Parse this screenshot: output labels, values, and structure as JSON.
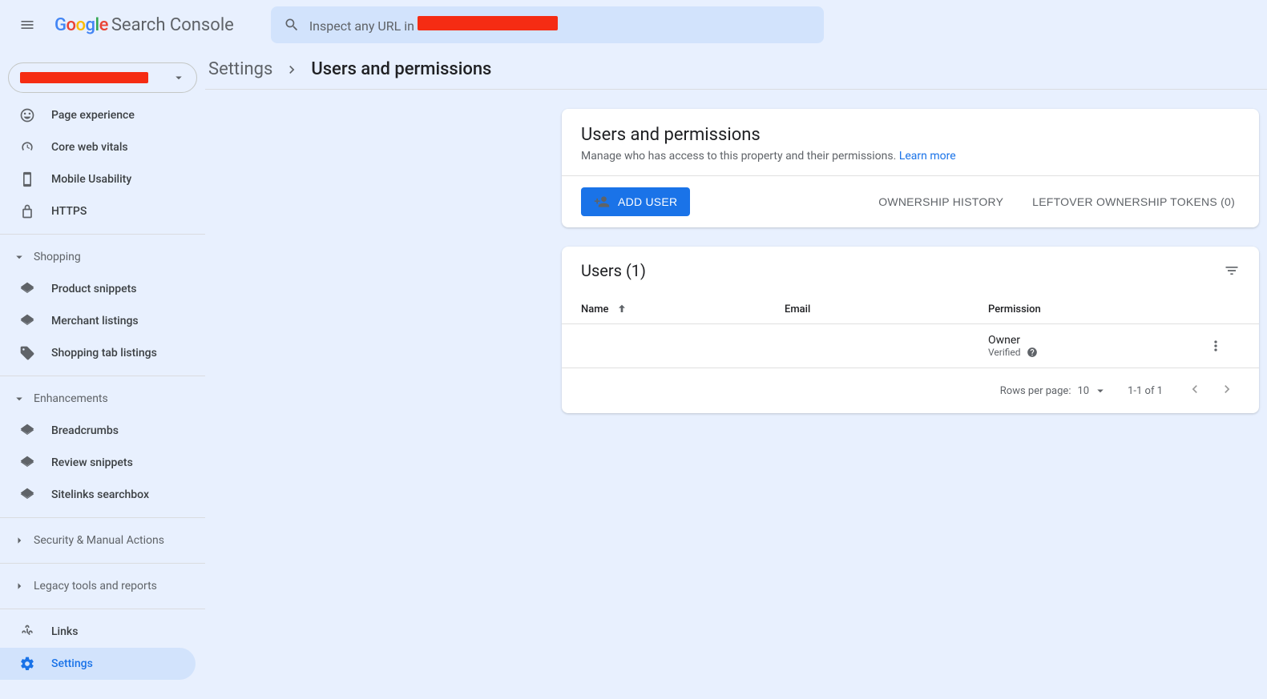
{
  "header": {
    "product_name": "Search Console",
    "search_placeholder_prefix": "Inspect any URL in "
  },
  "property": {
    "name_redacted": true
  },
  "sidebar": {
    "items_top": [
      {
        "icon": "page-experience",
        "label": "Page experience"
      },
      {
        "icon": "core-web-vitals",
        "label": "Core web vitals"
      },
      {
        "icon": "mobile",
        "label": "Mobile Usability"
      },
      {
        "icon": "lock",
        "label": "HTTPS"
      }
    ],
    "section_shopping": {
      "label": "Shopping",
      "items": [
        {
          "label": "Product snippets"
        },
        {
          "label": "Merchant listings"
        },
        {
          "label": "Shopping tab listings"
        }
      ]
    },
    "section_enhancements": {
      "label": "Enhancements",
      "items": [
        {
          "label": "Breadcrumbs"
        },
        {
          "label": "Review snippets"
        },
        {
          "label": "Sitelinks searchbox"
        }
      ]
    },
    "section_security": {
      "label": "Security & Manual Actions"
    },
    "section_legacy": {
      "label": "Legacy tools and reports"
    },
    "items_bottom": [
      {
        "icon": "links",
        "label": "Links"
      },
      {
        "icon": "settings",
        "label": "Settings",
        "active": true
      }
    ]
  },
  "breadcrumb": {
    "parent": "Settings",
    "current": "Users and permissions"
  },
  "card": {
    "title": "Users and permissions",
    "subtitle": "Manage who has access to this property and their permissions.",
    "learn_more": "Learn more",
    "add_user": "ADD USER",
    "ownership_history": "OWNERSHIP HISTORY",
    "leftover_tokens": "LEFTOVER OWNERSHIP TOKENS (0)"
  },
  "table": {
    "title": "Users (1)",
    "columns": {
      "name": "Name",
      "email": "Email",
      "permission": "Permission"
    },
    "rows": [
      {
        "name_redacted": true,
        "email_redacted": true,
        "permission": "Owner",
        "permission_sub": "Verified"
      }
    ],
    "pager": {
      "rows_per_page_label": "Rows per page:",
      "rows_per_page_value": "10",
      "range": "1-1 of 1"
    }
  }
}
